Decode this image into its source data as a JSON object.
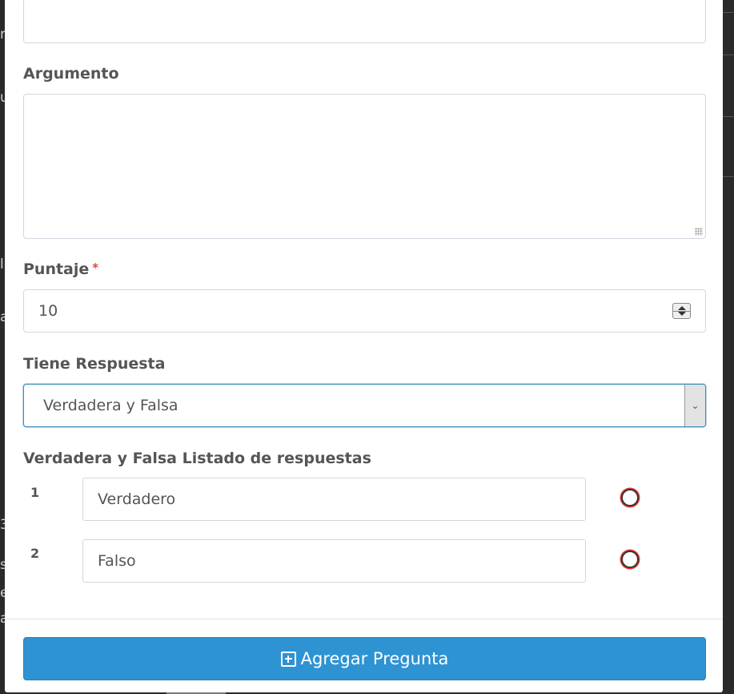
{
  "background_fragments": [
    "r",
    "u",
    "l",
    "a",
    "c",
    "3",
    "s",
    "e",
    "a"
  ],
  "form": {
    "argumento_label": "Argumento",
    "argumento_value": "",
    "puntaje_label": "Puntaje",
    "puntaje_required_mark": "*",
    "puntaje_value": "10",
    "tiene_respuesta_label": "Tiene Respuesta",
    "tiene_respuesta_selected": "Verdadera y Falsa",
    "answers_list_label": "Verdadera y Falsa Listado de respuestas",
    "answers": [
      {
        "number": "1",
        "text": "Verdadero",
        "correct": false
      },
      {
        "number": "2",
        "text": "Falso",
        "correct": false
      }
    ]
  },
  "footer": {
    "add_button_label": "Agregar Pregunta",
    "add_button_icon": "plus-square-icon"
  },
  "colors": {
    "primary_button": "#2e93d3",
    "required_mark": "#dd4b39",
    "focus_border": "#3c8dbc",
    "radio_outline": "#e53935"
  }
}
